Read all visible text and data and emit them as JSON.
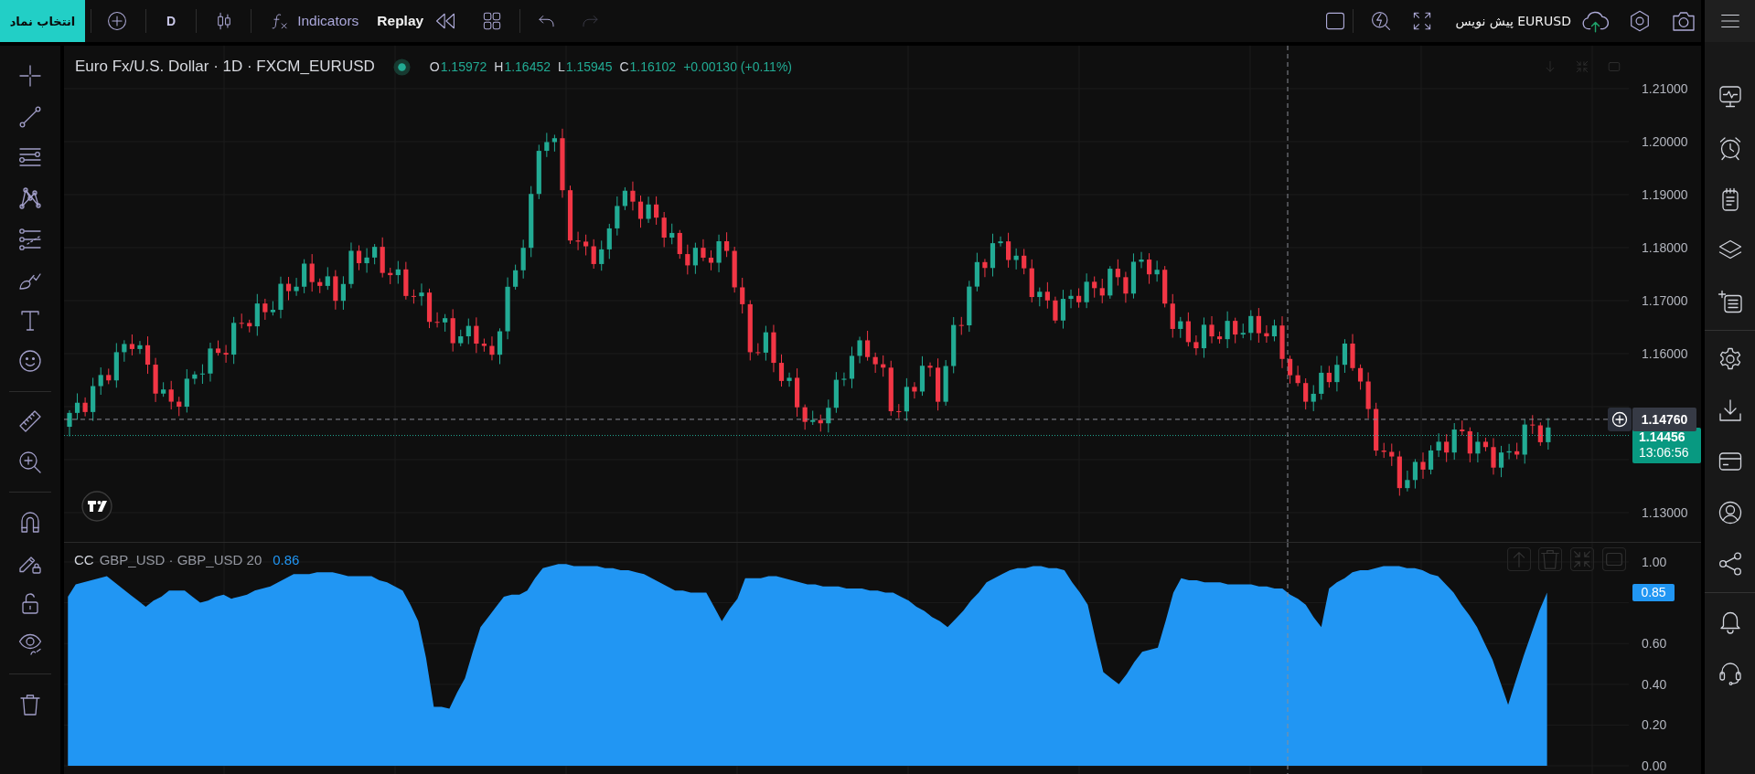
{
  "toolbar": {
    "symbol_button": "انتخاب نماد",
    "interval": "D",
    "indicators": "Indicators",
    "replay": "Replay",
    "undo": {
      "disabled": false
    },
    "redo": {
      "disabled": true
    },
    "layout_name": "EURUSD پیش نویس"
  },
  "chart_header": {
    "title": "Euro Fx/U.S. Dollar · 1D · FXCM_EURUSD",
    "ohlc": [
      {
        "label": "O",
        "value": "1.15972"
      },
      {
        "label": "H",
        "value": "1.16452"
      },
      {
        "label": "L",
        "value": "1.15945"
      },
      {
        "label": "C",
        "value": "1.16102"
      }
    ],
    "change": "+0.00130 (+0.11%)"
  },
  "price_scale": {
    "ticks": [
      "1.21000",
      "1.20000",
      "1.19000",
      "1.18000",
      "1.17000",
      "1.16000",
      "1.13000"
    ],
    "crosshair_price": "1.14760",
    "last_price": "1.14456",
    "countdown": "13:06:56"
  },
  "indicator": {
    "name": "CC",
    "params": "GBP_USD · GBP_USD 20",
    "value": "0.86",
    "last_value": "0.85",
    "chart_data": {
      "type": "area",
      "categories": [
        null,
        null,
        null,
        null,
        null,
        null,
        null,
        null,
        null,
        null,
        null,
        null,
        null,
        null,
        null,
        null,
        null,
        null,
        null,
        null,
        null,
        null,
        null,
        null,
        null,
        null,
        null,
        null,
        null,
        null,
        null,
        null,
        null,
        null,
        null,
        null,
        null,
        null,
        null,
        null,
        null,
        null,
        null,
        null,
        null,
        null,
        null,
        null,
        null,
        null,
        null,
        null,
        null,
        null,
        null,
        null,
        null,
        null,
        null,
        null,
        null,
        null,
        null,
        null,
        null,
        null,
        null,
        null,
        null,
        null,
        null,
        null,
        null,
        null,
        null,
        null,
        null,
        null,
        null,
        null,
        null,
        null,
        null,
        null,
        null,
        null,
        null,
        null,
        null,
        null,
        null,
        null,
        null,
        null,
        null,
        null,
        null,
        null,
        null,
        null,
        null,
        null,
        null,
        null,
        null,
        null,
        null,
        null,
        null,
        null,
        null,
        null,
        null,
        null,
        null,
        null,
        null,
        null,
        null,
        null,
        null,
        null,
        null,
        null,
        null,
        null,
        null,
        null,
        null,
        null,
        null,
        null,
        null,
        null,
        null,
        null,
        null,
        null,
        null,
        null,
        null,
        null,
        null,
        null,
        null,
        null,
        null,
        null,
        null,
        null,
        null,
        null,
        null,
        null,
        null,
        null,
        null,
        null,
        null,
        null,
        null,
        null,
        null,
        null,
        null,
        null,
        null,
        null,
        null,
        null,
        null,
        null,
        null,
        null,
        null,
        null,
        null,
        null,
        null,
        null,
        null,
        null,
        null,
        null,
        null,
        null,
        null,
        null,
        null,
        null,
        null,
        null,
        null,
        null,
        null,
        null,
        null,
        null,
        null,
        null,
        null
      ],
      "values": [
        0.83,
        0.89,
        0.9,
        0.91,
        0.92,
        0.93,
        0.9,
        0.87,
        0.84,
        0.81,
        0.78,
        0.81,
        0.83,
        0.86,
        0.86,
        0.86,
        0.83,
        0.8,
        0.81,
        0.83,
        0.84,
        0.82,
        0.83,
        0.84,
        0.86,
        0.87,
        0.88,
        0.9,
        0.92,
        0.94,
        0.94,
        0.94,
        0.95,
        0.95,
        0.95,
        0.94,
        0.93,
        0.93,
        0.93,
        0.93,
        0.91,
        0.9,
        0.88,
        0.86,
        0.79,
        0.71,
        0.53,
        0.29,
        0.29,
        0.28,
        0.36,
        0.43,
        0.56,
        0.68,
        0.73,
        0.78,
        0.83,
        0.84,
        0.84,
        0.86,
        0.92,
        0.97,
        0.98,
        0.99,
        0.99,
        0.98,
        0.98,
        0.98,
        0.98,
        0.97,
        0.97,
        0.96,
        0.96,
        0.95,
        0.94,
        0.92,
        0.9,
        0.88,
        0.86,
        0.86,
        0.85,
        0.85,
        0.85,
        0.78,
        0.71,
        0.77,
        0.82,
        0.92,
        0.92,
        0.92,
        0.93,
        0.93,
        0.92,
        0.91,
        0.9,
        0.89,
        0.89,
        0.88,
        0.88,
        0.88,
        0.87,
        0.87,
        0.87,
        0.86,
        0.86,
        0.85,
        0.85,
        0.83,
        0.81,
        0.78,
        0.76,
        0.73,
        0.71,
        0.68,
        0.72,
        0.76,
        0.81,
        0.85,
        0.9,
        0.92,
        0.94,
        0.96,
        0.97,
        0.97,
        0.98,
        0.98,
        0.97,
        0.97,
        0.96,
        0.9,
        0.85,
        0.79,
        0.62,
        0.46,
        0.43,
        0.4,
        0.45,
        0.51,
        0.56,
        0.57,
        0.58,
        0.71,
        0.85,
        0.92,
        0.91,
        0.91,
        0.9,
        0.9,
        0.9,
        0.89,
        0.89,
        0.89,
        0.89,
        0.88,
        0.88,
        0.87,
        0.87,
        0.84,
        0.82,
        0.79,
        0.73,
        0.68,
        0.87,
        0.9,
        0.92,
        0.95,
        0.96,
        0.96,
        0.97,
        0.98,
        0.98,
        0.98,
        0.97,
        0.97,
        0.96,
        0.94,
        0.93,
        0.89,
        0.85,
        0.79,
        0.74,
        0.68,
        0.6,
        0.52,
        0.41,
        0.3,
        0.42,
        0.54,
        0.65,
        0.76,
        0.85,
        null,
        null,
        null,
        null,
        null,
        null,
        null,
        null,
        null,
        null
      ],
      "ylim": [
        -0.04,
        1.094
      ],
      "yticks": [
        {
          "value": 1,
          "label": "1.00"
        },
        {
          "value": 0.6,
          "label": "0.60"
        },
        {
          "value": 0.4,
          "label": "0.40"
        },
        {
          "value": 0.2,
          "label": "0.20"
        },
        {
          "value": 0,
          "label": "0.00"
        }
      ],
      "grid": true
    }
  }
}
